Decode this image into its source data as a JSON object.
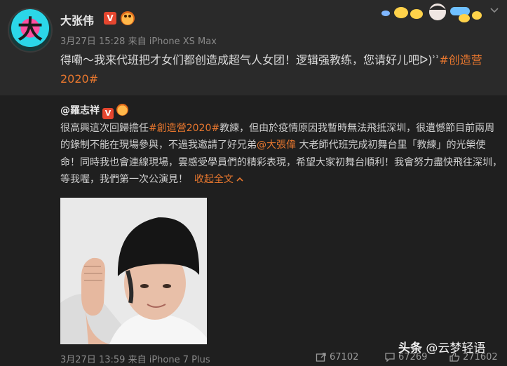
{
  "top_post": {
    "author": "大张伟",
    "avatar_glyph": "大",
    "timestamp": "3月27日 15:28",
    "source_prefix": "来自",
    "device": "iPhone XS Max",
    "text_main": "得嘞～我来代班把才女们都创造成超气人女团！逻辑强教练，您请好儿吧ᐅ)ʾʾ",
    "hashtag": "#创造营2020#"
  },
  "repost": {
    "author": "@羅志祥",
    "text_1": "很高興這次回歸擔任",
    "hashtag": "#創造營2020#",
    "text_2": "教練，但由於疫情原因我暫時無法飛抵深圳，很遺憾節目前兩周的錄制不能在現場參與，不過我邀請了好兄弟",
    "mention": "@大張偉",
    "text_3": " 大老師代班完成初舞台里「教練」的光榮使命！同時我也會連線現場，雲感受學員們的精彩表現，希望大家初舞台順利！我會努力盡快飛往深圳，等我喔，我們第一次公演見！",
    "collapse_label": "收起全文",
    "timestamp": "3月27日 13:59",
    "source_prefix": "来自",
    "device": "iPhone 7 Plus",
    "reposts": "67102",
    "comments": "67269",
    "likes": "271602"
  },
  "watermark": {
    "brand": "头条",
    "handle": "@云梦轻语"
  },
  "colors": {
    "accent": "#e8772e",
    "verified": "#e5462f",
    "background": "#232323"
  },
  "icons": [
    "chevron-down-icon",
    "verified-icon",
    "vip-icon",
    "repost-icon",
    "comment-icon",
    "like-icon",
    "collapse-up-icon"
  ]
}
